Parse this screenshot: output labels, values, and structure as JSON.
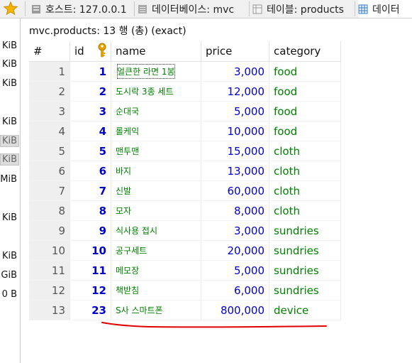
{
  "tabs": [
    {
      "label": "호스트: 127.0.0.1",
      "icon": "host-icon"
    },
    {
      "label": "데이터베이스: mvc",
      "icon": "database-icon"
    },
    {
      "label": "테이블: products",
      "icon": "table-icon"
    },
    {
      "label": "데이터",
      "icon": "grid-icon"
    }
  ],
  "sidebar": {
    "sizes": [
      "KiB",
      "KiB",
      "KiB",
      "KiB",
      "KiB",
      "KiB",
      "MiB",
      "KiB",
      "KiB",
      "GiB",
      "0 B"
    ]
  },
  "result": {
    "info": "mvc.products: 13 행 (총) (exact)"
  },
  "grid": {
    "columns": {
      "num": "#",
      "id": "id",
      "name": "name",
      "price": "price",
      "category": "category"
    },
    "rows": [
      {
        "num": "1",
        "id": "1",
        "name": "얼큰한 라면 1봉",
        "price": "3,000",
        "category": "food"
      },
      {
        "num": "2",
        "id": "2",
        "name": "도시락 3종 세트",
        "price": "12,000",
        "category": "food"
      },
      {
        "num": "3",
        "id": "3",
        "name": "순대국",
        "price": "5,000",
        "category": "food"
      },
      {
        "num": "4",
        "id": "4",
        "name": "롤케익",
        "price": "10,000",
        "category": "food"
      },
      {
        "num": "5",
        "id": "5",
        "name": "맨투맨",
        "price": "15,000",
        "category": "cloth"
      },
      {
        "num": "6",
        "id": "6",
        "name": "바지",
        "price": "13,000",
        "category": "cloth"
      },
      {
        "num": "7",
        "id": "7",
        "name": "신발",
        "price": "60,000",
        "category": "cloth"
      },
      {
        "num": "8",
        "id": "8",
        "name": "모자",
        "price": "8,000",
        "category": "cloth"
      },
      {
        "num": "9",
        "id": "9",
        "name": "식사용 접시",
        "price": "3,000",
        "category": "sundries"
      },
      {
        "num": "10",
        "id": "10",
        "name": "공구세트",
        "price": "20,000",
        "category": "sundries"
      },
      {
        "num": "11",
        "id": "11",
        "name": "메모장",
        "price": "5,000",
        "category": "sundries"
      },
      {
        "num": "12",
        "id": "12",
        "name": "책받침",
        "price": "6,000",
        "category": "sundries"
      },
      {
        "num": "13",
        "id": "23",
        "name": "S사 스마트폰",
        "price": "800,000",
        "category": "device"
      }
    ]
  },
  "colors": {
    "id_blue": "#0000cc",
    "text_green": "#008000",
    "annotation_red": "#e00000"
  }
}
